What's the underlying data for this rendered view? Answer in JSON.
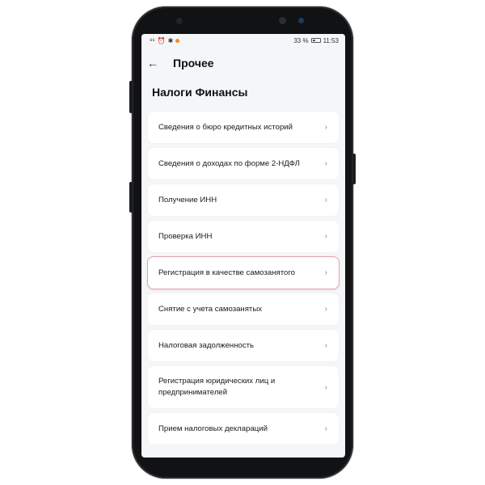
{
  "status": {
    "left_icons": [
      "signal-icon",
      "alarm-icon",
      "bluetooth-icon",
      "app-notification-icon"
    ],
    "battery": "33 %",
    "time": "11:53"
  },
  "header": {
    "back_icon": "←",
    "title": "Прочее"
  },
  "section_title": "Налоги Финансы",
  "items": [
    {
      "label": "Сведения о бюро кредитных историй"
    },
    {
      "label": "Сведения о доходах по форме 2-НДФЛ"
    },
    {
      "label": "Получение ИНН"
    },
    {
      "label": "Проверка ИНН"
    },
    {
      "label": "Регистрация в качестве самозанятого"
    },
    {
      "label": "Снятие с учета самозанятых"
    },
    {
      "label": "Налоговая задолженность"
    },
    {
      "label": "Регистрация юридических лиц и предпринимателей"
    },
    {
      "label": "Прием налоговых деклараций"
    }
  ],
  "chevron": "›",
  "colors": {
    "highlight_border": "#e6a3ad",
    "accent_dot": "#f08a24"
  }
}
